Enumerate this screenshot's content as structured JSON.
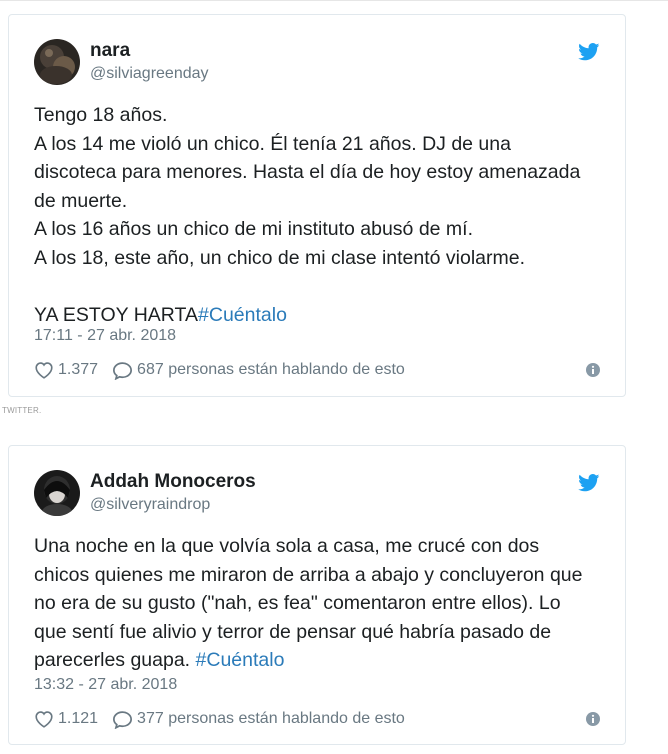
{
  "caption": "TWITTER.",
  "tweets": [
    {
      "name": "nara",
      "handle": "@silviagreenday",
      "lines": [
        "Tengo 18 años.",
        "A los 14 me violó un chico. Él tenía 21 años. DJ de una",
        "discoteca para menores. Hasta el día de hoy estoy amenazada",
        "de muerte.",
        "A los 16 años un chico de mi instituto abusó de mí.",
        "A los 18, este año, un chico de mi clase intentó violarme."
      ],
      "final_text": "YA ESTOY HARTA",
      "hashtag": "#Cuéntalo",
      "timestamp": "17:11 - 27 abr. 2018",
      "likes": "1.377",
      "replies": "687 personas están hablando de esto"
    },
    {
      "name": "Addah Monoceros",
      "handle": "@silveryraindrop",
      "lines": [
        "Una noche en la que volvía sola a casa, me crucé con dos",
        "chicos quienes me miraron de arriba a abajo y concluyeron que",
        "no era de su gusto (\"nah, es fea\" comentaron entre ellos). Lo",
        "que sentí fue alivio y terror de pensar qué habría pasado de"
      ],
      "final_text": "parecerles guapa. ",
      "hashtag": "#Cuéntalo",
      "timestamp": "13:32 - 27 abr. 2018",
      "likes": "1.121",
      "replies": "377 personas están hablando de esto"
    }
  ],
  "icons": {
    "brand": "twitter-bird-icon",
    "like": "heart-icon",
    "reply": "speech-bubble-icon",
    "info": "info-icon"
  },
  "colors": {
    "twitter_blue": "#1da1f2",
    "hashtag": "#2b7bb9",
    "muted": "#697882",
    "text": "#1c2022"
  }
}
